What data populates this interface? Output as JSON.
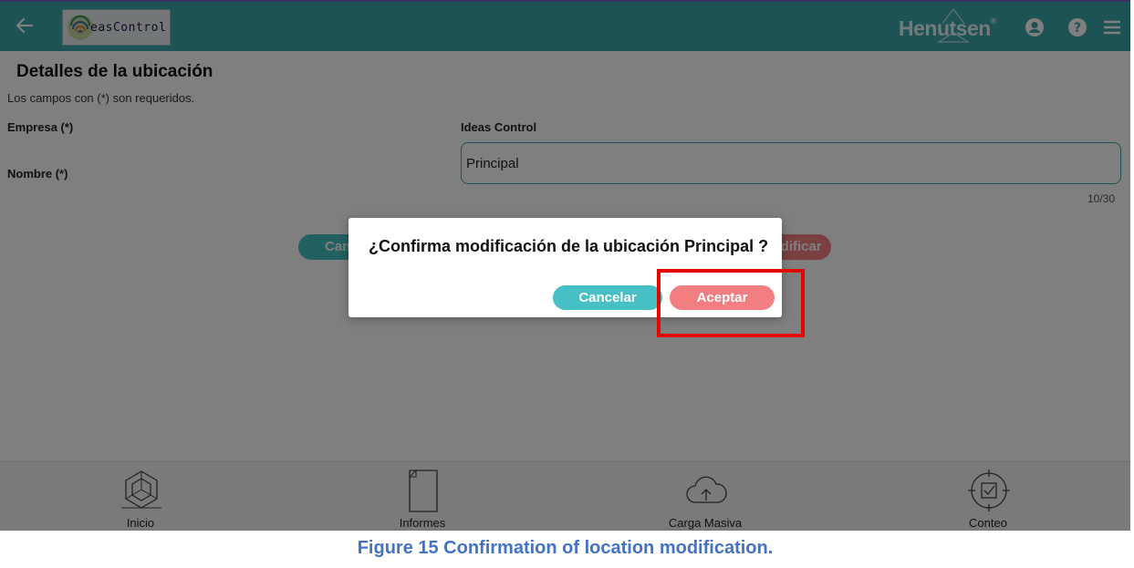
{
  "header": {
    "logo_text": "easControl",
    "brand": "Henutsen",
    "brand_sup": "®"
  },
  "form": {
    "title": "Detalles de la ubicación",
    "required_note": "Los campos con (*) son requeridos.",
    "company_label": "Empresa (*)",
    "company_value": "Ideas Control",
    "name_label": "Nombre (*)",
    "name_value": "Principal",
    "name_counter": "10/30",
    "cancel_label": "Cancelar",
    "save_label": "Modificar"
  },
  "dialog": {
    "message": "¿Confirma modificación de la ubicación Principal ?",
    "cancel_label": "Cancelar",
    "accept_label": "Aceptar"
  },
  "bottom_nav": [
    {
      "label": "Inicio",
      "icon": "cube-icon"
    },
    {
      "label": "Informes",
      "icon": "document-icon"
    },
    {
      "label": "Carga Masiva",
      "icon": "cloud-upload-icon"
    },
    {
      "label": "Conteo",
      "icon": "target-check-icon"
    }
  ],
  "caption": "Figure 15 Confirmation of location modification.",
  "colors": {
    "header": "#3aa6a9",
    "primary": "#46c0c4",
    "danger": "#f27e82",
    "highlight": "#e60000",
    "caption": "#4472c4"
  }
}
